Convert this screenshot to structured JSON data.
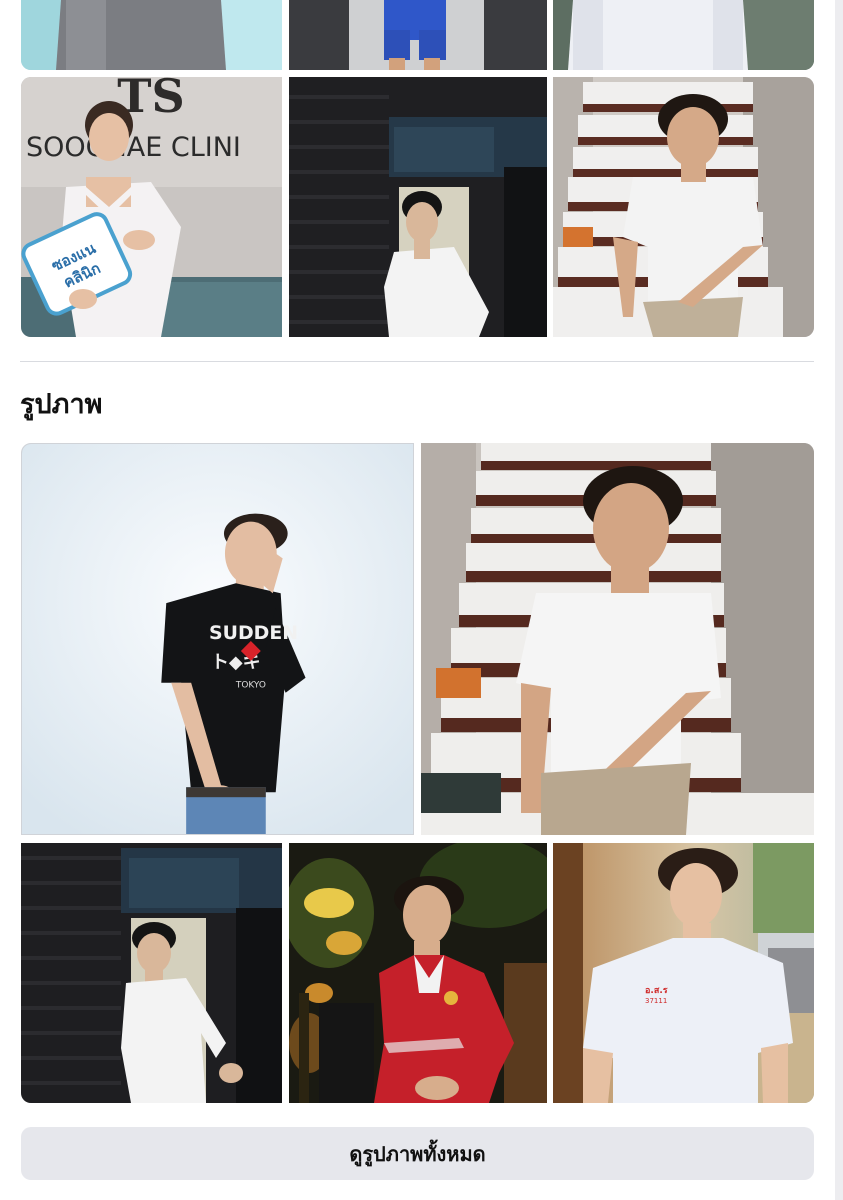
{
  "section": {
    "title": "รูปภาพ"
  },
  "see_all_button": {
    "label": "ดูรูปภาพทั้งหมด"
  },
  "photos": {
    "clinic_sign": "SOOGNAE CLINI",
    "clinic_logo": "TS",
    "clinic_card_line1": "ซองแน",
    "clinic_card_line2": "คลินิก",
    "shirt_text": "SUDDEN",
    "shirt_text2": "TOKYO"
  }
}
